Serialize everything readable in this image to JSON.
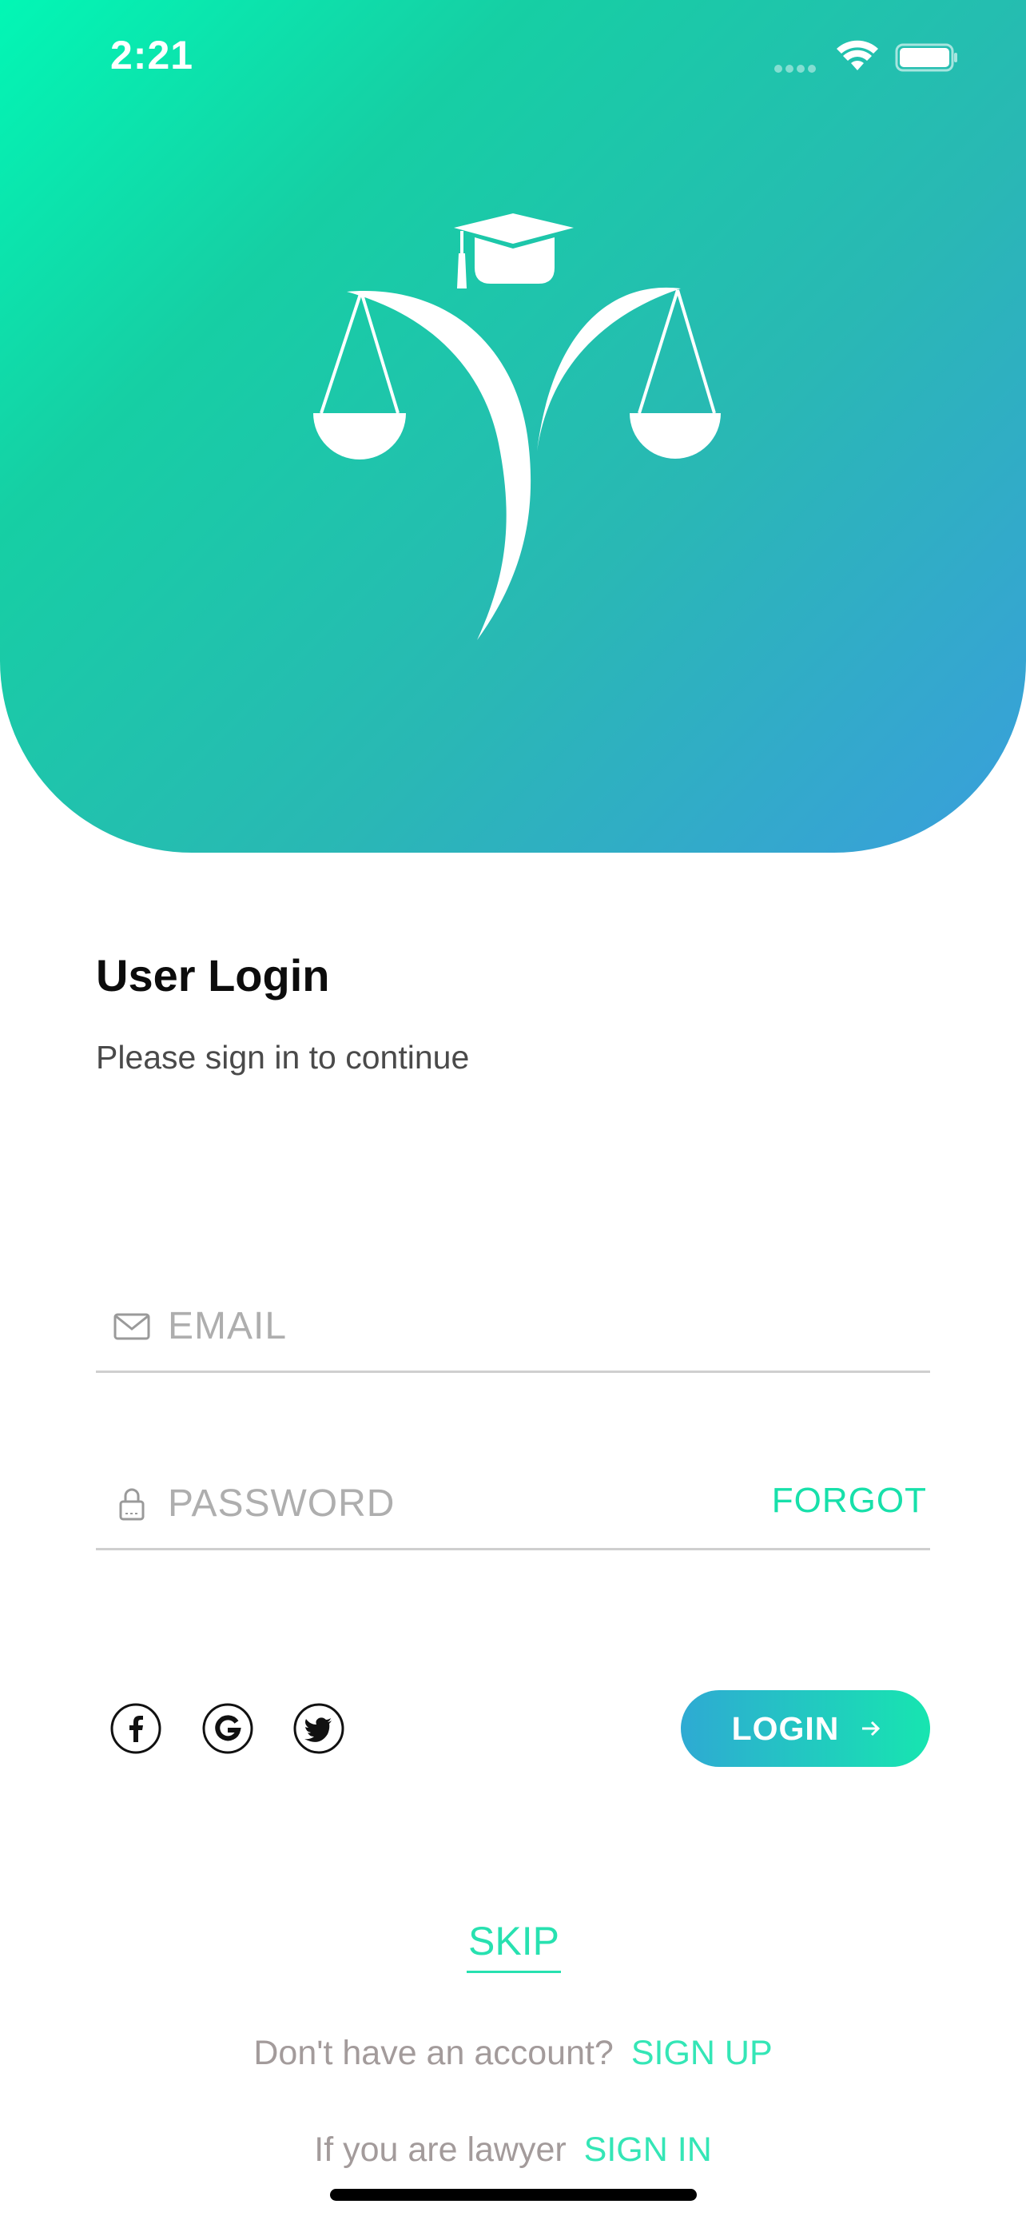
{
  "status_bar": {
    "time": "2:21",
    "icons": [
      "signal-dots-icon",
      "wifi-icon",
      "battery-icon"
    ]
  },
  "header": {
    "logo": "scales-of-justice-graduation-cap-logo",
    "gradient": [
      "#02f7b5",
      "#3a9edd"
    ]
  },
  "login": {
    "title": "User Login",
    "subtitle": "Please sign in to continue",
    "email_placeholder": "EMAIL",
    "password_placeholder": "PASSWORD",
    "forgot_label": "FORGOT",
    "login_label": "LOGIN",
    "social": [
      "facebook-icon",
      "google-icon",
      "twitter-icon"
    ]
  },
  "footer": {
    "skip_label": "SKIP",
    "no_account_text": "Don't have an account?",
    "signup_label": "SIGN UP",
    "lawyer_text": "If you are lawyer",
    "signin_label": "SIGN IN"
  },
  "colors": {
    "accent": "#17e0aa",
    "link": "#34e6b6",
    "muted": "#a39b9b"
  }
}
